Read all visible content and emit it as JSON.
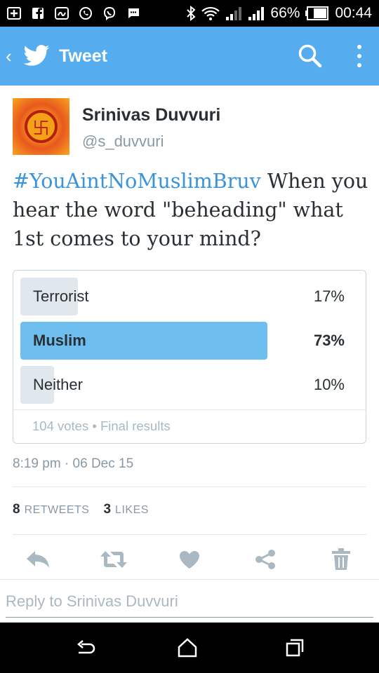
{
  "status_bar": {
    "battery": "66%",
    "time": "00:44"
  },
  "app_bar": {
    "title": "Tweet",
    "back_icon": "chevron-left-icon",
    "logo_icon": "twitter-bird-icon",
    "search_icon": "search-icon",
    "more_icon": "more-vertical-icon",
    "color": "#55acee"
  },
  "tweet": {
    "author_name": "Srinivas Duvvuri",
    "author_handle": "@s_duvvuri",
    "hashtag": "#YouAintNoMuslimBruv",
    "text": " When you hear the word \"beheading\" what 1st comes to your mind?",
    "timestamp": "8:19 pm · 06 Dec 15"
  },
  "poll": {
    "options": [
      {
        "label": "Terrorist",
        "percent_label": "17%",
        "percent": 17,
        "winner": false
      },
      {
        "label": "Muslim",
        "percent_label": "73%",
        "percent": 73,
        "winner": true
      },
      {
        "label": "Neither",
        "percent_label": "10%",
        "percent": 10,
        "winner": false
      }
    ],
    "footer": "104 votes • Final results",
    "winner_color": "#6ebfef",
    "bar_color": "#e1e8ed"
  },
  "stats": {
    "retweets_count": "8",
    "retweets_label": "RETWEETS",
    "likes_count": "3",
    "likes_label": "LIKES"
  },
  "actions": {
    "icons": [
      "reply-icon",
      "retweet-icon",
      "like-icon",
      "share-icon",
      "delete-icon"
    ],
    "icon_color": "#aab8c2"
  },
  "reply": {
    "placeholder": "Reply to Srinivas Duvvuri"
  },
  "nav_bar": {
    "icons": [
      "back-nav-icon",
      "home-nav-icon",
      "recents-nav-icon"
    ]
  }
}
